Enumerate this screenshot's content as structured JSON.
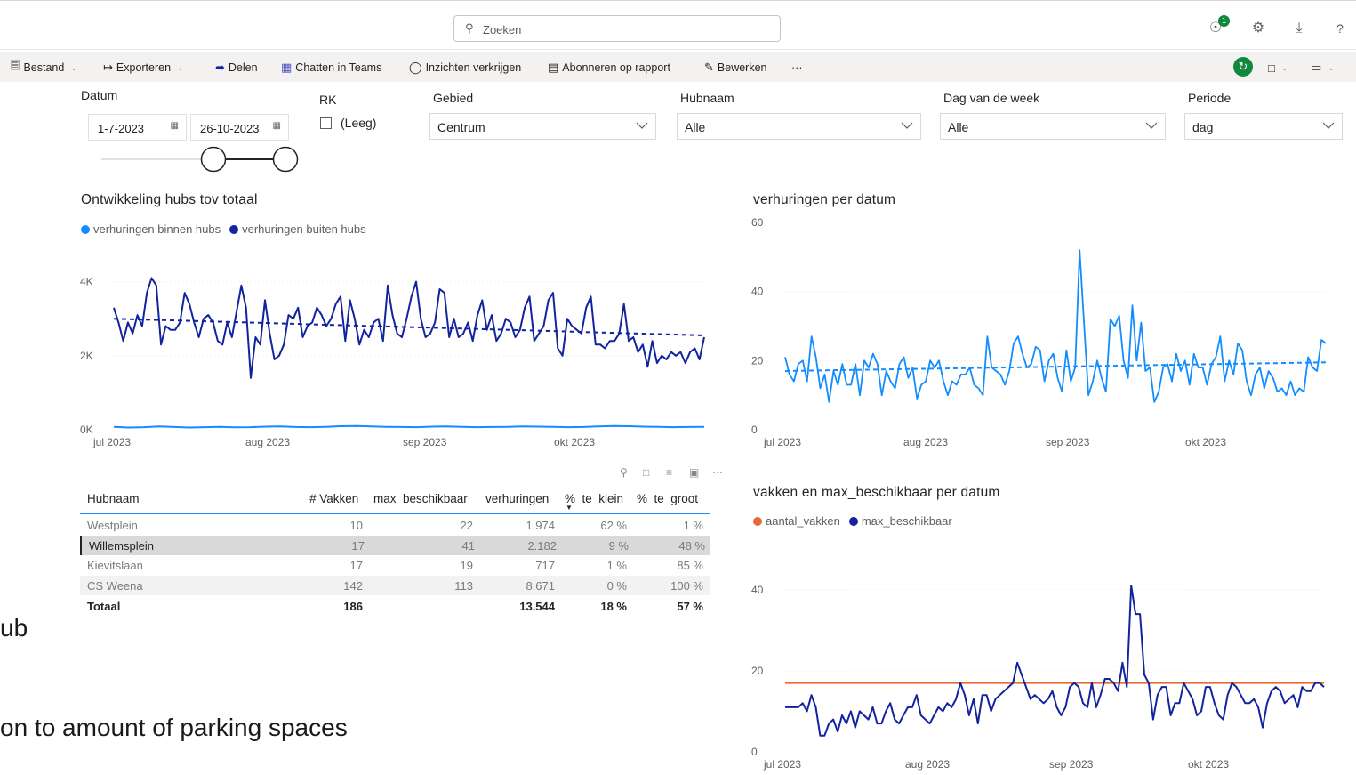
{
  "topbar": {
    "search_placeholder": "Zoeken",
    "notification_count": "1",
    "help_label": "?"
  },
  "commands": {
    "bestand": "Bestand",
    "exporteren": "Exporteren",
    "delen": "Delen",
    "chatten": "Chatten in Teams",
    "inzichten": "Inzichten verkrijgen",
    "abonneren": "Abonneren op rapport",
    "bewerken": "Bewerken",
    "more": "···"
  },
  "filters": {
    "datum": {
      "label": "Datum",
      "start": "1-7-2023",
      "end": "26-10-2023"
    },
    "rk": {
      "label": "RK",
      "option": "(Leeg)"
    },
    "gebied": {
      "label": "Gebied",
      "value": "Centrum"
    },
    "hubnaam": {
      "label": "Hubnaam",
      "value": "Alle"
    },
    "dag": {
      "label": "Dag van de week",
      "value": "Alle"
    },
    "periode": {
      "label": "Periode",
      "value": "dag"
    }
  },
  "colors": {
    "accent_dark": "#12239e",
    "accent_light": "#118dff",
    "orange": "#e66c37",
    "green": "#10893e"
  },
  "chart_data": [
    {
      "type": "line",
      "title": "Ontwikkeling hubs tov totaal",
      "x_ticks": [
        "jul 2023",
        "aug 2023",
        "sep 2023",
        "okt 2023"
      ],
      "y_ticks": [
        "0K",
        "2K",
        "4K"
      ],
      "ylim": [
        0,
        4400
      ],
      "legend_position": "top-left",
      "series": [
        {
          "name": "verhuringen binnen hubs",
          "color": "#118dff",
          "values": [
            80,
            60,
            70,
            90,
            75,
            60,
            70,
            80,
            65,
            70,
            85,
            90,
            75,
            70,
            80,
            95,
            100,
            90,
            80,
            75,
            70,
            85,
            90,
            80,
            70,
            75,
            80,
            90,
            85,
            80,
            70,
            75,
            90,
            100,
            95,
            85,
            80,
            70,
            75,
            80
          ]
        },
        {
          "name": "verhuringen buiten hubs",
          "color": "#12239e",
          "values": [
            3300,
            2900,
            2400,
            2900,
            2600,
            3100,
            2800,
            3700,
            4100,
            3900,
            2300,
            2800,
            2700,
            2700,
            2900,
            3700,
            3400,
            2900,
            2500,
            3000,
            3100,
            2900,
            2400,
            2300,
            2900,
            2500,
            3200,
            3900,
            3300,
            1400,
            2500,
            2300,
            3500,
            2600,
            1900,
            2000,
            2300,
            3100,
            3000,
            3300,
            2500,
            2800,
            2900,
            3300,
            3100,
            2800,
            3000,
            3400,
            3600,
            2400,
            3500,
            3000,
            2300,
            2700,
            2500,
            2900,
            3000,
            2400,
            3900,
            3100,
            2600,
            2500,
            3000,
            3600,
            4000,
            3000,
            2500,
            2600,
            2900,
            3800,
            3700,
            2500,
            3000,
            2500,
            2600,
            2900,
            2400,
            3100,
            3500,
            2700,
            3100,
            2400,
            2600,
            3000,
            2900,
            2500,
            2700,
            3300,
            3600,
            2400,
            2600,
            2800,
            3500,
            3700,
            2200,
            2000,
            3000,
            2800,
            2700,
            2600,
            3300,
            3600,
            2300,
            2300,
            2200,
            2400,
            2400,
            2600,
            3400,
            2400,
            2500,
            2100,
            2300,
            1700,
            2400,
            1800,
            2000,
            1900,
            2100,
            2000,
            2100,
            1800,
            2100,
            2200,
            1900,
            2500
          ],
          "trend": [
            3000,
            2550
          ]
        }
      ]
    },
    {
      "type": "line",
      "title": "verhuringen per datum",
      "x_ticks": [
        "jul 2023",
        "aug 2023",
        "sep 2023",
        "okt 2023"
      ],
      "y_ticks": [
        "0",
        "20",
        "40",
        "60"
      ],
      "ylim": [
        0,
        60
      ],
      "series": [
        {
          "name": "",
          "color": "#118dff",
          "values": [
            21,
            16,
            14,
            19,
            20,
            14,
            27,
            21,
            12,
            16,
            8,
            17,
            13,
            19,
            13,
            13,
            19,
            10,
            20,
            18,
            22,
            19,
            10,
            17,
            14,
            12,
            19,
            21,
            15,
            18,
            9,
            13,
            14,
            20,
            18,
            20,
            14,
            10,
            14,
            13,
            16,
            16,
            18,
            13,
            12,
            10,
            27,
            18,
            17,
            16,
            13,
            17,
            25,
            27,
            22,
            18,
            19,
            24,
            23,
            14,
            20,
            22,
            15,
            11,
            23,
            14,
            18,
            52,
            31,
            10,
            14,
            20,
            15,
            11,
            32,
            30,
            33,
            20,
            15,
            36,
            20,
            31,
            17,
            18,
            8,
            11,
            18,
            19,
            14,
            22,
            17,
            20,
            13,
            22,
            18,
            18,
            13,
            19,
            21,
            27,
            14,
            20,
            16,
            25,
            23,
            14,
            10,
            16,
            18,
            12,
            17,
            15,
            11,
            12,
            10,
            14,
            10,
            12,
            11,
            21,
            18,
            17,
            26,
            25
          ]
        }
      ],
      "trend": [
        17,
        19.5
      ]
    },
    {
      "type": "line",
      "title": "vakken en max_beschikbaar per datum",
      "x_ticks": [
        "jul 2023",
        "aug 2023",
        "sep 2023",
        "okt 2023"
      ],
      "y_ticks": [
        "0",
        "20",
        "40"
      ],
      "ylim": [
        0,
        45
      ],
      "legend_position": "top-left",
      "series": [
        {
          "name": "aantal_vakken",
          "color": "#e66c37",
          "values": [
            17,
            17
          ]
        },
        {
          "name": "max_beschikbaar",
          "color": "#12239e",
          "values": [
            11,
            11,
            11,
            11,
            12,
            10,
            14,
            11,
            4,
            4,
            7,
            8,
            5,
            9,
            7,
            10,
            6,
            10,
            9,
            8,
            11,
            7,
            7,
            10,
            12,
            8,
            7,
            9,
            11,
            11,
            14,
            9,
            8,
            7,
            9,
            11,
            10,
            12,
            11,
            13,
            17,
            14,
            9,
            13,
            7,
            14,
            14,
            10,
            13,
            14,
            15,
            16,
            17,
            22,
            19,
            16,
            13,
            14,
            13,
            12,
            13,
            15,
            11,
            9,
            11,
            16,
            17,
            16,
            12,
            11,
            17,
            11,
            14,
            18,
            18,
            17,
            15,
            22,
            16,
            41,
            34,
            34,
            19,
            17,
            8,
            14,
            16,
            16,
            9,
            12,
            12,
            17,
            15,
            13,
            9,
            10,
            16,
            16,
            12,
            9,
            8,
            14,
            17,
            16,
            14,
            12,
            12,
            13,
            11,
            6,
            12,
            15,
            16,
            15,
            12,
            13,
            14,
            11,
            16,
            15,
            15,
            17,
            17,
            16
          ]
        }
      ]
    }
  ],
  "table": {
    "headers": [
      "Hubnaam",
      "# Vakken",
      "max_beschikbaar",
      "verhuringen",
      "%_te_klein",
      "%_te_groot"
    ],
    "rows": [
      [
        "Westplein",
        "10",
        "22",
        "1.974",
        "62 %",
        "1 %"
      ],
      [
        "Willemsplein",
        "17",
        "41",
        "2.182",
        "9 %",
        "48 %"
      ],
      [
        "Kievitslaan",
        "17",
        "19",
        "717",
        "1 %",
        "85 %"
      ],
      [
        "CS Weena",
        "142",
        "113",
        "8.671",
        "0 %",
        "100 %"
      ]
    ],
    "total": [
      "Totaal",
      "186",
      "",
      "13.544",
      "18 %",
      "57 %"
    ]
  },
  "background_text": {
    "line1": "ub",
    "line2": "on to amount of parking spaces"
  }
}
